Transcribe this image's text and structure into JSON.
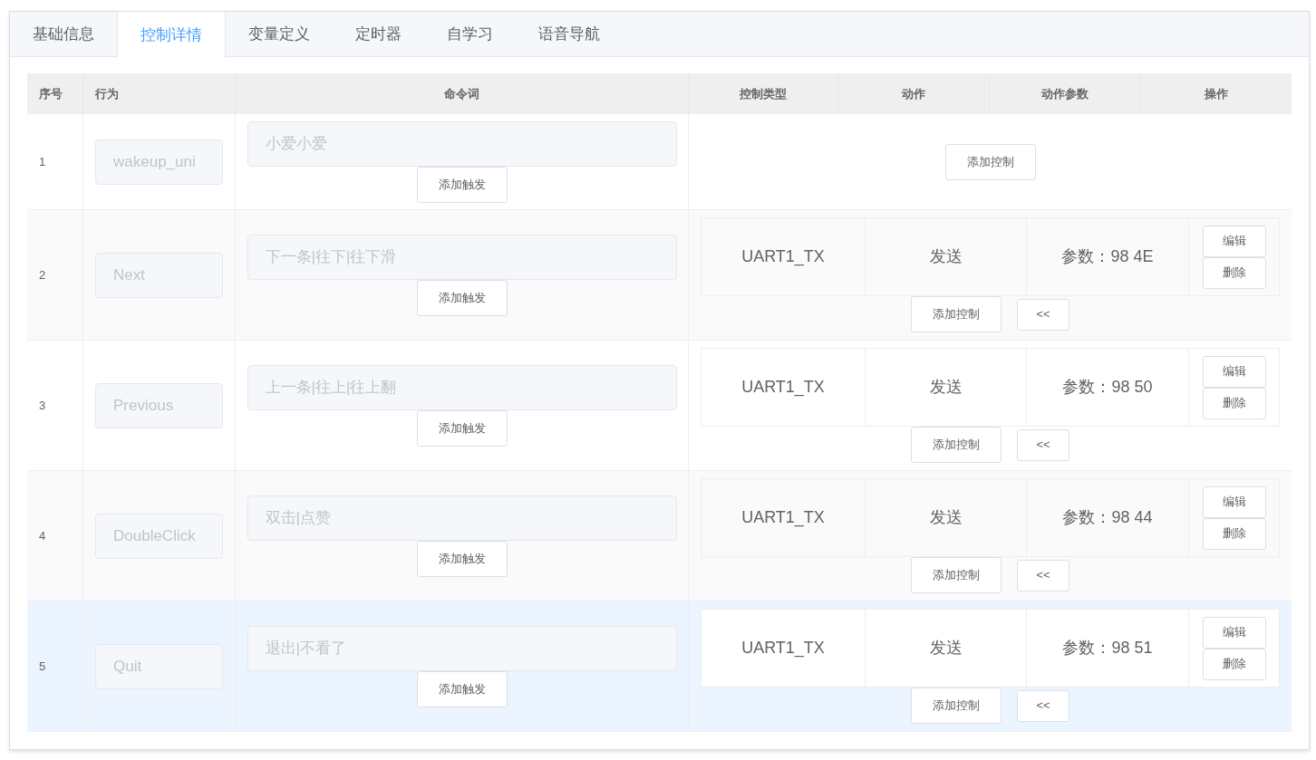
{
  "tabs": [
    {
      "label": "基础信息",
      "selected": false
    },
    {
      "label": "控制详情",
      "selected": true
    },
    {
      "label": "变量定义",
      "selected": false
    },
    {
      "label": "定时器",
      "selected": false
    },
    {
      "label": "自学习",
      "selected": false
    },
    {
      "label": "语音导航",
      "selected": false
    }
  ],
  "table": {
    "columns": [
      "序号",
      "行为",
      "命令词",
      "控制类型",
      "动作",
      "动作参数",
      "操作"
    ],
    "rows": [
      {
        "index": "1",
        "behavior": "wakeup_uni",
        "command": "小爱小爱",
        "add_trigger": "添加触发",
        "highlighted": false,
        "controls": [],
        "add_control": "添加控制",
        "collapse": null
      },
      {
        "index": "2",
        "behavior": "Next",
        "command": "下一条|往下|往下滑",
        "add_trigger": "添加触发",
        "highlighted": false,
        "controls": [
          {
            "type": "UART1_TX",
            "action": "发送",
            "param": "参数：98 4E",
            "edit": "编辑",
            "delete": "删除"
          }
        ],
        "add_control": "添加控制",
        "collapse": "<<"
      },
      {
        "index": "3",
        "behavior": "Previous",
        "command": "上一条|往上|往上翻",
        "add_trigger": "添加触发",
        "highlighted": false,
        "controls": [
          {
            "type": "UART1_TX",
            "action": "发送",
            "param": "参数：98 50",
            "edit": "编辑",
            "delete": "删除"
          }
        ],
        "add_control": "添加控制",
        "collapse": "<<"
      },
      {
        "index": "4",
        "behavior": "DoubleClick",
        "command": "双击|点赞",
        "add_trigger": "添加触发",
        "highlighted": false,
        "controls": [
          {
            "type": "UART1_TX",
            "action": "发送",
            "param": "参数：98 44",
            "edit": "编辑",
            "delete": "删除"
          }
        ],
        "add_control": "添加控制",
        "collapse": "<<"
      },
      {
        "index": "5",
        "behavior": "Quit",
        "command": "退出|不看了",
        "add_trigger": "添加触发",
        "highlighted": true,
        "controls": [
          {
            "type": "UART1_TX",
            "action": "发送",
            "param": "参数：98 51",
            "edit": "编辑",
            "delete": "删除"
          }
        ],
        "add_control": "添加控制",
        "collapse": "<<"
      }
    ]
  }
}
